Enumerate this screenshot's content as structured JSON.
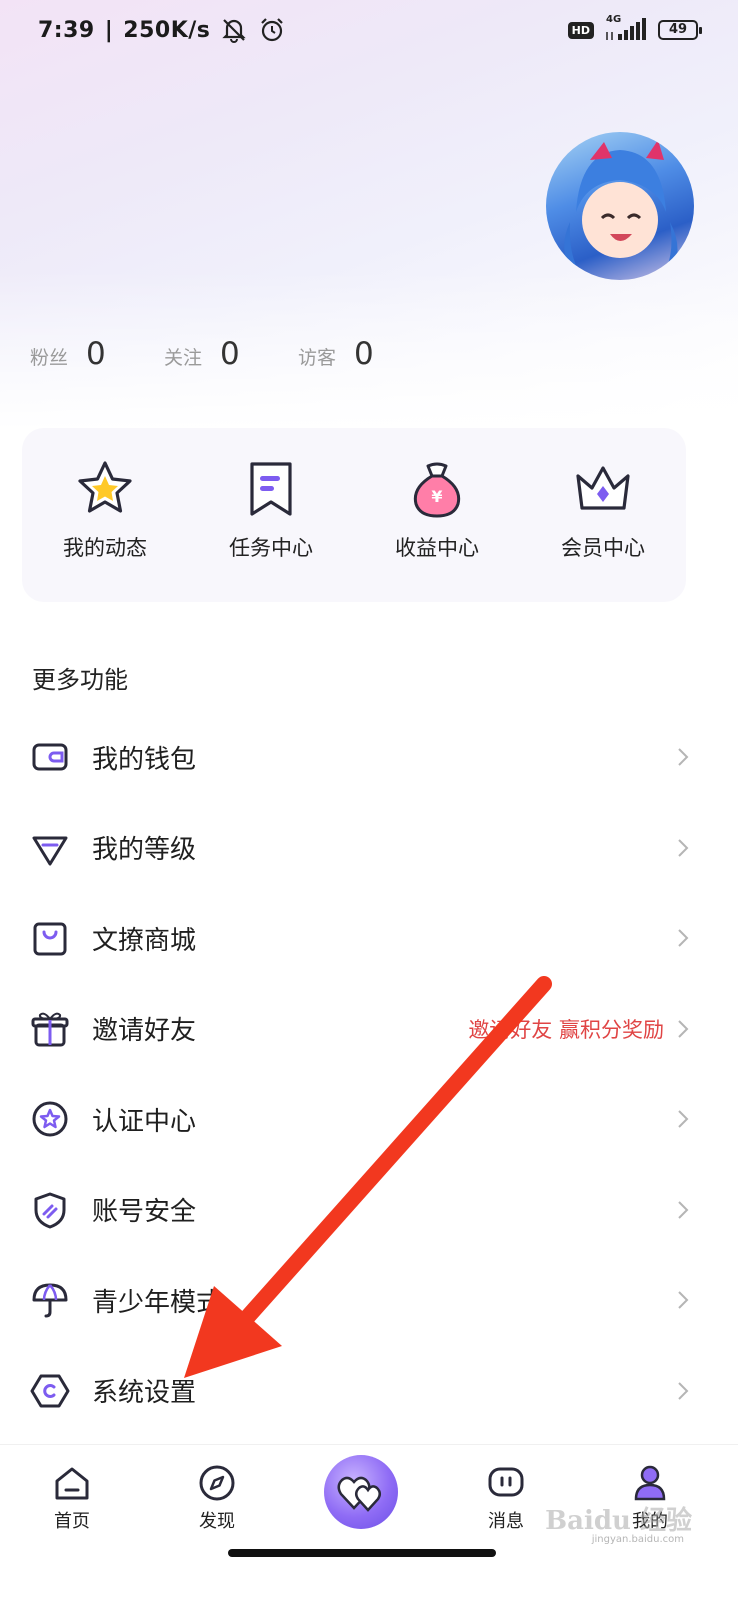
{
  "status_bar": {
    "time": "7:39",
    "speed": "250K/s",
    "hd": "HD",
    "network": "4G",
    "battery": "49"
  },
  "profile": {
    "stats": [
      {
        "label": "粉丝",
        "value": "0"
      },
      {
        "label": "关注",
        "value": "0"
      },
      {
        "label": "访客",
        "value": "0"
      }
    ]
  },
  "quick_actions": [
    {
      "label": "我的动态",
      "icon": "star-icon"
    },
    {
      "label": "任务中心",
      "icon": "bookmark-icon"
    },
    {
      "label": "收益中心",
      "icon": "money-bag-icon"
    },
    {
      "label": "会员中心",
      "icon": "crown-icon"
    }
  ],
  "more": {
    "title": "更多功能",
    "items": [
      {
        "label": "我的钱包",
        "icon": "wallet-icon",
        "extra": ""
      },
      {
        "label": "我的等级",
        "icon": "diamond-icon",
        "extra": ""
      },
      {
        "label": "文撩商城",
        "icon": "shopping-bag-icon",
        "extra": ""
      },
      {
        "label": "邀请好友",
        "icon": "gift-icon",
        "extra": "邀请好友 赢积分奖励"
      },
      {
        "label": "认证中心",
        "icon": "certified-star-icon",
        "extra": ""
      },
      {
        "label": "账号安全",
        "icon": "shield-icon",
        "extra": ""
      },
      {
        "label": "青少年模式",
        "icon": "umbrella-icon",
        "extra": ""
      },
      {
        "label": "系统设置",
        "icon": "settings-hexagon-icon",
        "extra": ""
      }
    ]
  },
  "tabbar": {
    "items": [
      {
        "label": "首页",
        "icon": "home-icon"
      },
      {
        "label": "发现",
        "icon": "compass-icon"
      },
      {
        "label": "",
        "icon": "hearts-icon"
      },
      {
        "label": "消息",
        "icon": "message-icon"
      },
      {
        "label": "我的",
        "icon": "profile-icon"
      }
    ]
  },
  "watermark": {
    "text": "Baidu 经验",
    "sub": "jingyan.baidu.com"
  },
  "colors": {
    "accent": "#7d5cf0",
    "highlight": "#e04545",
    "arrow": "#f2381f"
  }
}
